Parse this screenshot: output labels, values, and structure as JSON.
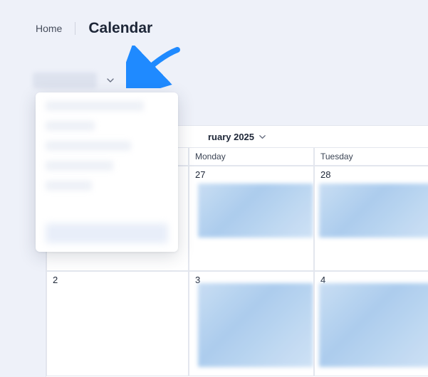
{
  "breadcrumb": {
    "home": "Home",
    "current": "Calendar"
  },
  "filter": {
    "label": "",
    "caret_icon": "chevron-down"
  },
  "dropdown": {
    "items": [
      "",
      "",
      "",
      "",
      ""
    ],
    "footer": ""
  },
  "calendar": {
    "month_label": "ruary 2025",
    "columns": [
      "",
      "Monday",
      "Tuesday"
    ],
    "rows": [
      {
        "cells": [
          {
            "day": "",
            "has_event": false
          },
          {
            "day": "27",
            "has_event": true
          },
          {
            "day": "28",
            "has_event": true
          }
        ]
      },
      {
        "cells": [
          {
            "day": "2",
            "has_event": false
          },
          {
            "day": "3",
            "has_event": true
          },
          {
            "day": "4",
            "has_event": true
          }
        ]
      }
    ]
  },
  "colors": {
    "page_bg": "#eef1f9",
    "event_bg": "#b9d5f1",
    "arrow": "#1f8aff"
  }
}
